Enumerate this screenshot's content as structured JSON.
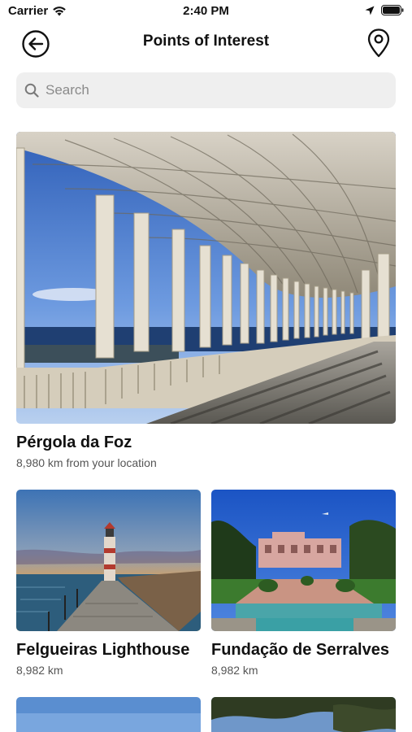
{
  "status_bar": {
    "carrier": "Carrier",
    "time": "2:40 PM"
  },
  "nav": {
    "title": "Points of Interest",
    "back_icon": "arrow-left-circle-icon",
    "location_icon": "map-pin-icon"
  },
  "search": {
    "placeholder": "Search",
    "value": ""
  },
  "places": [
    {
      "name": "Pérgola da Foz",
      "distance": "8,980 km from your location"
    },
    {
      "name": "Felgueiras Lighthouse",
      "distance": "8,982 km"
    },
    {
      "name": "Fundação de Serralves",
      "distance": "8,982 km"
    }
  ],
  "colors": {
    "search_bg": "#efefef",
    "text_primary": "#111111",
    "text_secondary": "#555555"
  }
}
